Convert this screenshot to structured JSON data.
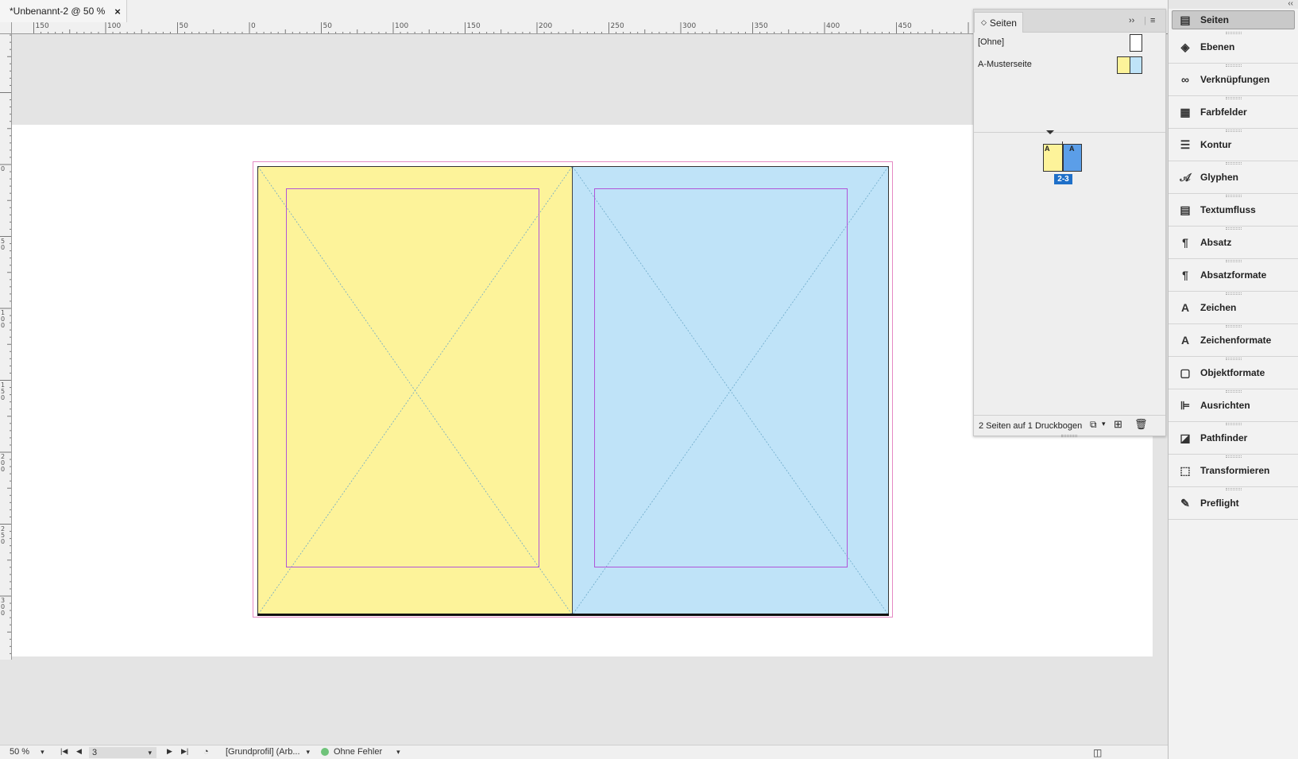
{
  "document": {
    "tab_title": "*Unbenannt-2 @ 50 %",
    "close_glyph": "×"
  },
  "ruler": {
    "h_labels": [
      "150",
      "100",
      "50",
      "0",
      "50",
      "100",
      "150",
      "200",
      "250",
      "300",
      "350",
      "400",
      "450"
    ],
    "v_labels": [
      "0",
      "50",
      "100",
      "150",
      "200",
      "250",
      "300"
    ]
  },
  "spread": {
    "left_page_color": "#fdf39a",
    "right_page_color": "#bfe3f8",
    "bleed_color": "#e58ac4",
    "margin_color": "#b054d8"
  },
  "pages_panel": {
    "tab_label": "Seiten",
    "expand_glyph": "››",
    "menu_glyph": "≡",
    "masters": [
      {
        "label": "[Ohne]"
      },
      {
        "label": "A-Musterseite"
      }
    ],
    "spread_label": "2-3",
    "page_prefix_left": "A",
    "page_prefix_right": "A",
    "footer_text": "2 Seiten auf 1 Druckbogen"
  },
  "dock": {
    "collapse_glyph": "‹‹",
    "items": [
      {
        "label": "Seiten",
        "icon": "pages-icon"
      },
      {
        "label": "Ebenen",
        "icon": "layers-icon"
      },
      {
        "label": "Verknüpfungen",
        "icon": "links-icon"
      },
      {
        "label": "Farbfelder",
        "icon": "swatches-icon"
      },
      {
        "label": "Kontur",
        "icon": "stroke-icon"
      },
      {
        "label": "Glyphen",
        "icon": "glyphs-icon"
      },
      {
        "label": "Textumfluss",
        "icon": "text-wrap-icon"
      },
      {
        "label": "Absatz",
        "icon": "paragraph-icon"
      },
      {
        "label": "Absatzformate",
        "icon": "paragraph-styles-icon"
      },
      {
        "label": "Zeichen",
        "icon": "character-icon"
      },
      {
        "label": "Zeichenformate",
        "icon": "character-styles-icon"
      },
      {
        "label": "Objektformate",
        "icon": "object-styles-icon"
      },
      {
        "label": "Ausrichten",
        "icon": "align-icon"
      },
      {
        "label": "Pathfinder",
        "icon": "pathfinder-icon"
      },
      {
        "label": "Transformieren",
        "icon": "transform-icon"
      },
      {
        "label": "Preflight",
        "icon": "preflight-icon"
      }
    ]
  },
  "statusbar": {
    "zoom": "50 %",
    "page_number": "3",
    "profile": "[Grundprofil] (Arb...",
    "preflight_status": "Ohne Fehler"
  }
}
